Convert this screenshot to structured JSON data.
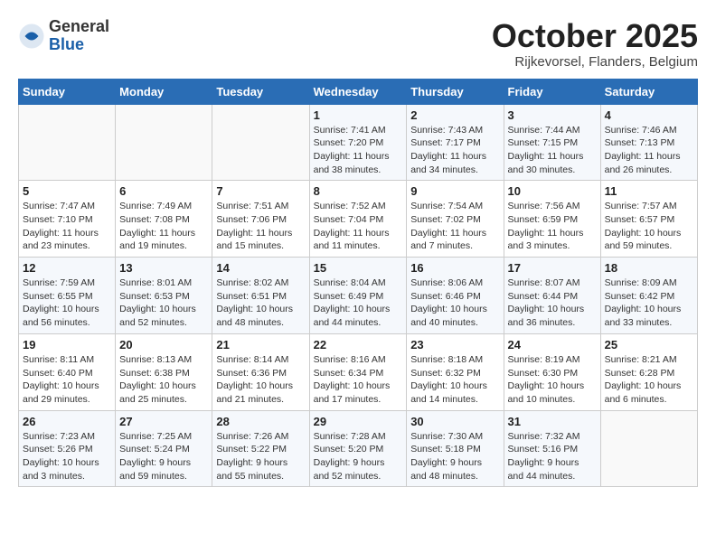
{
  "header": {
    "logo_general": "General",
    "logo_blue": "Blue",
    "month": "October 2025",
    "location": "Rijkevorsel, Flanders, Belgium"
  },
  "weekdays": [
    "Sunday",
    "Monday",
    "Tuesday",
    "Wednesday",
    "Thursday",
    "Friday",
    "Saturday"
  ],
  "weeks": [
    [
      {
        "day": "",
        "info": ""
      },
      {
        "day": "",
        "info": ""
      },
      {
        "day": "",
        "info": ""
      },
      {
        "day": "1",
        "info": "Sunrise: 7:41 AM\nSunset: 7:20 PM\nDaylight: 11 hours\nand 38 minutes."
      },
      {
        "day": "2",
        "info": "Sunrise: 7:43 AM\nSunset: 7:17 PM\nDaylight: 11 hours\nand 34 minutes."
      },
      {
        "day": "3",
        "info": "Sunrise: 7:44 AM\nSunset: 7:15 PM\nDaylight: 11 hours\nand 30 minutes."
      },
      {
        "day": "4",
        "info": "Sunrise: 7:46 AM\nSunset: 7:13 PM\nDaylight: 11 hours\nand 26 minutes."
      }
    ],
    [
      {
        "day": "5",
        "info": "Sunrise: 7:47 AM\nSunset: 7:10 PM\nDaylight: 11 hours\nand 23 minutes."
      },
      {
        "day": "6",
        "info": "Sunrise: 7:49 AM\nSunset: 7:08 PM\nDaylight: 11 hours\nand 19 minutes."
      },
      {
        "day": "7",
        "info": "Sunrise: 7:51 AM\nSunset: 7:06 PM\nDaylight: 11 hours\nand 15 minutes."
      },
      {
        "day": "8",
        "info": "Sunrise: 7:52 AM\nSunset: 7:04 PM\nDaylight: 11 hours\nand 11 minutes."
      },
      {
        "day": "9",
        "info": "Sunrise: 7:54 AM\nSunset: 7:02 PM\nDaylight: 11 hours\nand 7 minutes."
      },
      {
        "day": "10",
        "info": "Sunrise: 7:56 AM\nSunset: 6:59 PM\nDaylight: 11 hours\nand 3 minutes."
      },
      {
        "day": "11",
        "info": "Sunrise: 7:57 AM\nSunset: 6:57 PM\nDaylight: 10 hours\nand 59 minutes."
      }
    ],
    [
      {
        "day": "12",
        "info": "Sunrise: 7:59 AM\nSunset: 6:55 PM\nDaylight: 10 hours\nand 56 minutes."
      },
      {
        "day": "13",
        "info": "Sunrise: 8:01 AM\nSunset: 6:53 PM\nDaylight: 10 hours\nand 52 minutes."
      },
      {
        "day": "14",
        "info": "Sunrise: 8:02 AM\nSunset: 6:51 PM\nDaylight: 10 hours\nand 48 minutes."
      },
      {
        "day": "15",
        "info": "Sunrise: 8:04 AM\nSunset: 6:49 PM\nDaylight: 10 hours\nand 44 minutes."
      },
      {
        "day": "16",
        "info": "Sunrise: 8:06 AM\nSunset: 6:46 PM\nDaylight: 10 hours\nand 40 minutes."
      },
      {
        "day": "17",
        "info": "Sunrise: 8:07 AM\nSunset: 6:44 PM\nDaylight: 10 hours\nand 36 minutes."
      },
      {
        "day": "18",
        "info": "Sunrise: 8:09 AM\nSunset: 6:42 PM\nDaylight: 10 hours\nand 33 minutes."
      }
    ],
    [
      {
        "day": "19",
        "info": "Sunrise: 8:11 AM\nSunset: 6:40 PM\nDaylight: 10 hours\nand 29 minutes."
      },
      {
        "day": "20",
        "info": "Sunrise: 8:13 AM\nSunset: 6:38 PM\nDaylight: 10 hours\nand 25 minutes."
      },
      {
        "day": "21",
        "info": "Sunrise: 8:14 AM\nSunset: 6:36 PM\nDaylight: 10 hours\nand 21 minutes."
      },
      {
        "day": "22",
        "info": "Sunrise: 8:16 AM\nSunset: 6:34 PM\nDaylight: 10 hours\nand 17 minutes."
      },
      {
        "day": "23",
        "info": "Sunrise: 8:18 AM\nSunset: 6:32 PM\nDaylight: 10 hours\nand 14 minutes."
      },
      {
        "day": "24",
        "info": "Sunrise: 8:19 AM\nSunset: 6:30 PM\nDaylight: 10 hours\nand 10 minutes."
      },
      {
        "day": "25",
        "info": "Sunrise: 8:21 AM\nSunset: 6:28 PM\nDaylight: 10 hours\nand 6 minutes."
      }
    ],
    [
      {
        "day": "26",
        "info": "Sunrise: 7:23 AM\nSunset: 5:26 PM\nDaylight: 10 hours\nand 3 minutes."
      },
      {
        "day": "27",
        "info": "Sunrise: 7:25 AM\nSunset: 5:24 PM\nDaylight: 9 hours\nand 59 minutes."
      },
      {
        "day": "28",
        "info": "Sunrise: 7:26 AM\nSunset: 5:22 PM\nDaylight: 9 hours\nand 55 minutes."
      },
      {
        "day": "29",
        "info": "Sunrise: 7:28 AM\nSunset: 5:20 PM\nDaylight: 9 hours\nand 52 minutes."
      },
      {
        "day": "30",
        "info": "Sunrise: 7:30 AM\nSunset: 5:18 PM\nDaylight: 9 hours\nand 48 minutes."
      },
      {
        "day": "31",
        "info": "Sunrise: 7:32 AM\nSunset: 5:16 PM\nDaylight: 9 hours\nand 44 minutes."
      },
      {
        "day": "",
        "info": ""
      }
    ]
  ]
}
